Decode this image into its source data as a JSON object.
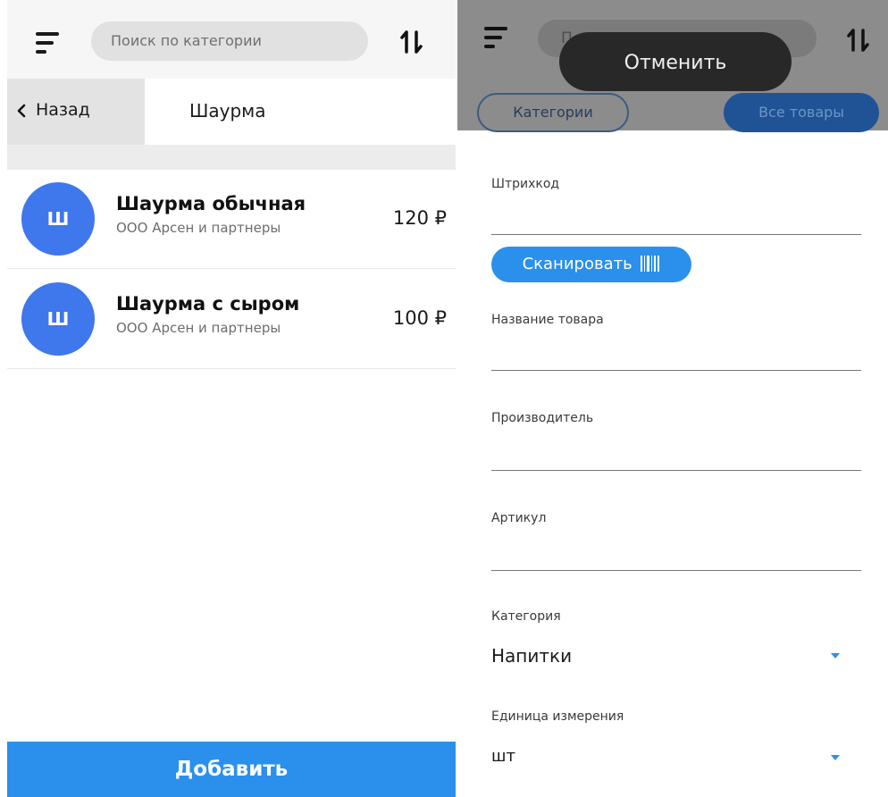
{
  "left_screen": {
    "search": {
      "placeholder": "Поиск по категории"
    },
    "back_label": "Назад",
    "category_title": "Шаурма",
    "products": [
      {
        "initial": "Ш",
        "name": "Шаурма обычная",
        "maker": "ООО Арсен и партнеры",
        "price": "120 ₽"
      },
      {
        "initial": "Ш",
        "name": "Шаурма с сыром",
        "maker": "ООО Арсен и партнеры",
        "price": "100 ₽"
      }
    ],
    "add_button": "Добавить"
  },
  "right_screen": {
    "toast": "Отменить",
    "tabs": {
      "categories": "Категории",
      "all_products": "Все товары"
    },
    "fields": {
      "barcode": "Штрихкод",
      "scan_button": "Сканировать",
      "product_name": "Название товара",
      "manufacturer": "Производитель",
      "article": "Артикул",
      "category_label": "Категория",
      "category_value": "Напитки",
      "unit_label": "Единица измерения",
      "unit_value": "шт"
    }
  },
  "colors": {
    "accent_blue": "#2a90ec",
    "avatar_blue": "#3f77ec",
    "overlay_gray": "#8c8c8c",
    "toast_dark": "#282828"
  },
  "icons": [
    "menu-icon",
    "sort-icon",
    "chevron-left-icon",
    "barcode-icon",
    "dropdown-caret-icon"
  ]
}
